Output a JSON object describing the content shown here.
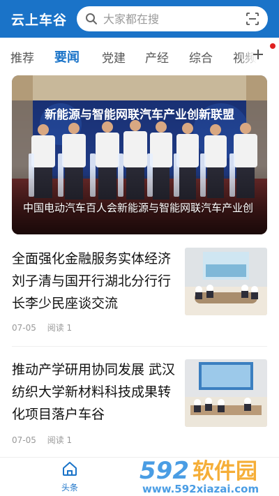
{
  "header": {
    "app_title": "云上车谷",
    "search_placeholder": "大家都在搜",
    "icons": [
      "search-icon",
      "scan-icon"
    ],
    "color": "#1a73c8"
  },
  "tabs": [
    {
      "label": "推荐",
      "active": false
    },
    {
      "label": "要闻",
      "active": true
    },
    {
      "label": "党建",
      "active": false
    },
    {
      "label": "产经",
      "active": false
    },
    {
      "label": "综合",
      "active": false
    },
    {
      "label": "视频",
      "active": false
    }
  ],
  "hero": {
    "banner_text": "新能源与智能网联汽车产业创新联盟",
    "caption": "中国电动汽车百人会新能源与智能网联汽车产业创新联盟"
  },
  "news": [
    {
      "title": "全面强化金融服务实体经济 刘子清与国开行湖北分行行长李少民座谈交流",
      "date": "07-05",
      "reads": "阅读 1"
    },
    {
      "title": "推动产学研用协同发展 武汉纺织大学新材料科技成果转化项目落户车谷",
      "date": "07-05",
      "reads": "阅读 1"
    }
  ],
  "bottom_nav": {
    "home_label": "头条"
  },
  "watermark": {
    "number": "592",
    "name": "软件园",
    "url": "www.592xiazai.com"
  }
}
